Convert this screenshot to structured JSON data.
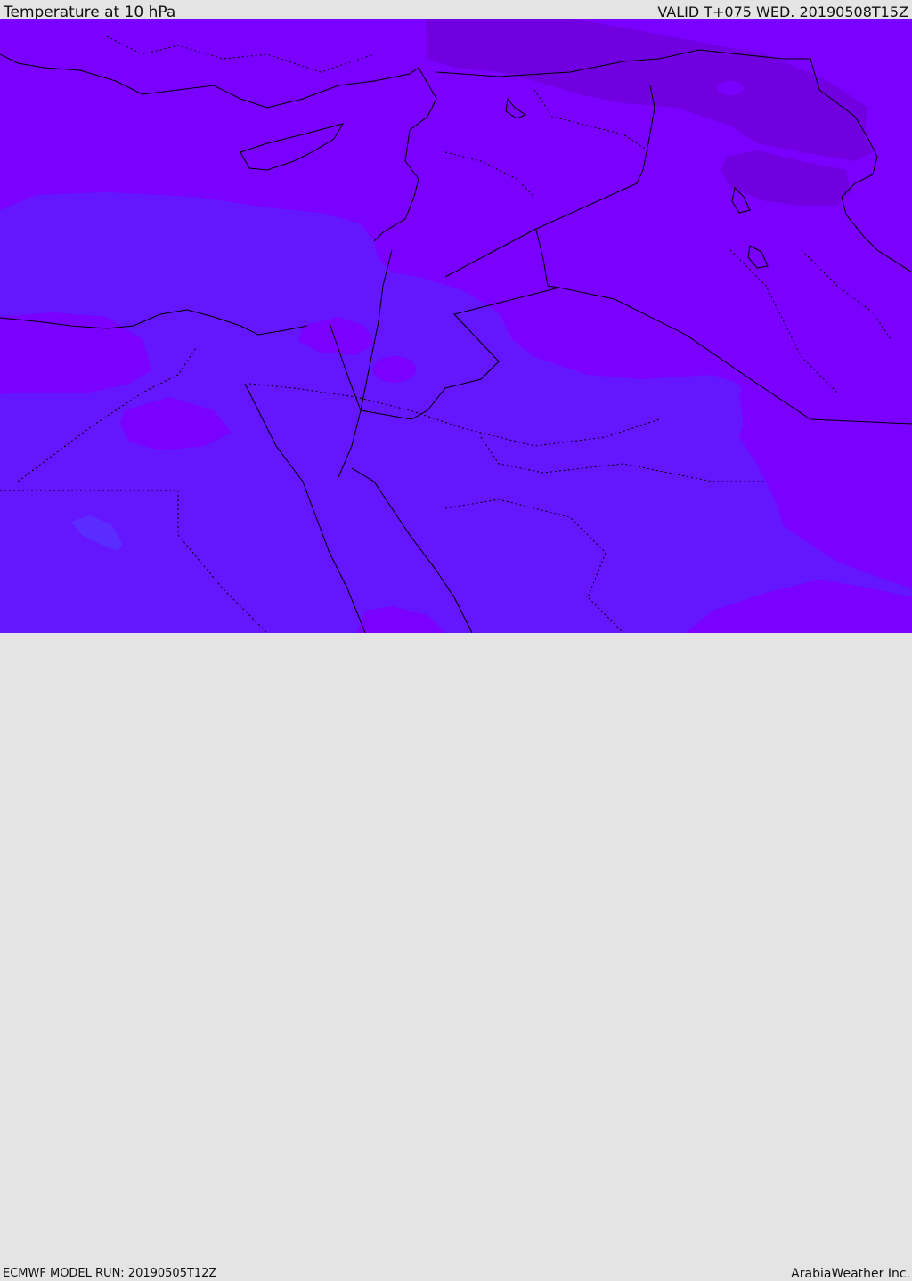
{
  "header": {
    "title": "Temperature at 10 hPa",
    "valid": "VALID T+075 WED. 20190508T15Z"
  },
  "footer": {
    "model_run": "ECMWF MODEL RUN: 20190505T12Z",
    "credit": "ArabiaWeather Inc."
  },
  "colors": {
    "base_field": "#7a00ff",
    "cold_field": "#6416ff",
    "colder_patch": "#5a2cff",
    "warm_field": "#7000e0",
    "border": "#000000"
  }
}
